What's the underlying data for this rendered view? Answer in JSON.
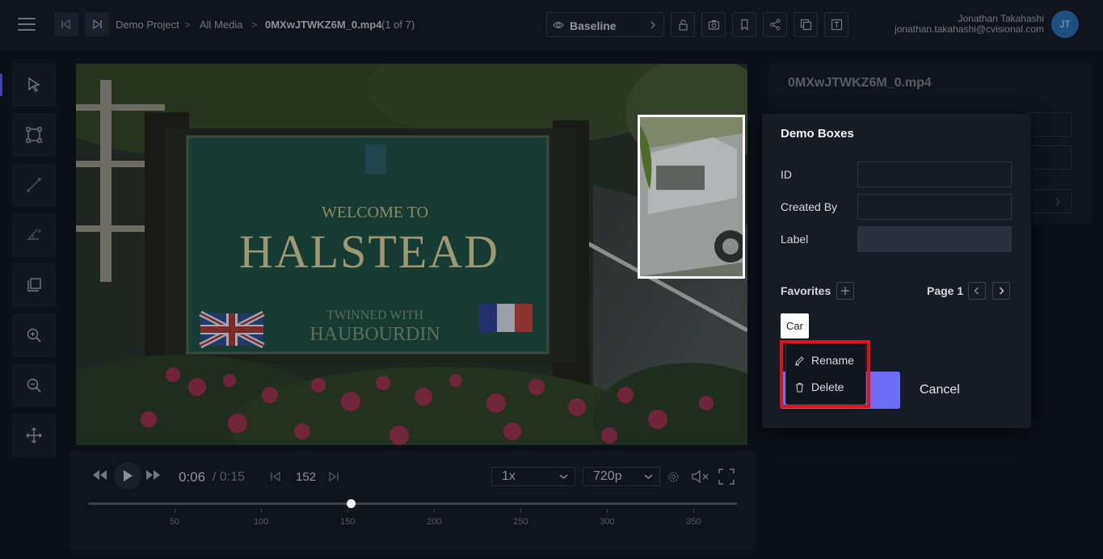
{
  "header": {
    "breadcrumbs": [
      "Demo Project",
      "All Media",
      "0MXwJTWKZ6M_0.mp4",
      "(1 of 7)"
    ],
    "separator": ">",
    "version_label": "Baseline",
    "user_name": "Jonathan Takahashi",
    "user_email": "jonathan.takahashi@cvisional.com",
    "avatar_initials": "JT"
  },
  "tools": [
    "pointer-icon",
    "bounding-box-icon",
    "line-icon",
    "angle-icon",
    "copy-frames-icon",
    "zoom-in-icon",
    "zoom-out-icon",
    "move-icon"
  ],
  "video": {
    "sign_line1": "WELCOME TO",
    "sign_line2": "HALSTEAD",
    "sign_line3": "TWINNED WITH",
    "sign_line4": "HAUBOURDIN"
  },
  "controls": {
    "current_time": "0:06",
    "total_time": "/ 0:15",
    "frame": "152",
    "speed": "1x",
    "quality": "720p",
    "timeline_ticks": [
      "50",
      "100",
      "150",
      "200",
      "250",
      "300",
      "350"
    ],
    "playhead_frame": 152
  },
  "right_panel": {
    "title": "0MXwJTWKZ6M_0.mp4"
  },
  "modal": {
    "title": "Demo Boxes",
    "fields": {
      "id_label": "ID",
      "id_value": "",
      "created_by_label": "Created By",
      "created_by_value": "",
      "label_label": "Label",
      "label_value": ""
    },
    "favorites_label": "Favorites",
    "page_label": "Page 1",
    "favorite_chip": "Car",
    "cancel_label": "Cancel"
  },
  "context_menu": {
    "rename": "Rename",
    "delete": "Delete"
  },
  "colors": {
    "accent": "#6c6cf6",
    "highlight": "#e0121c",
    "avatar": "#1d4f80"
  }
}
